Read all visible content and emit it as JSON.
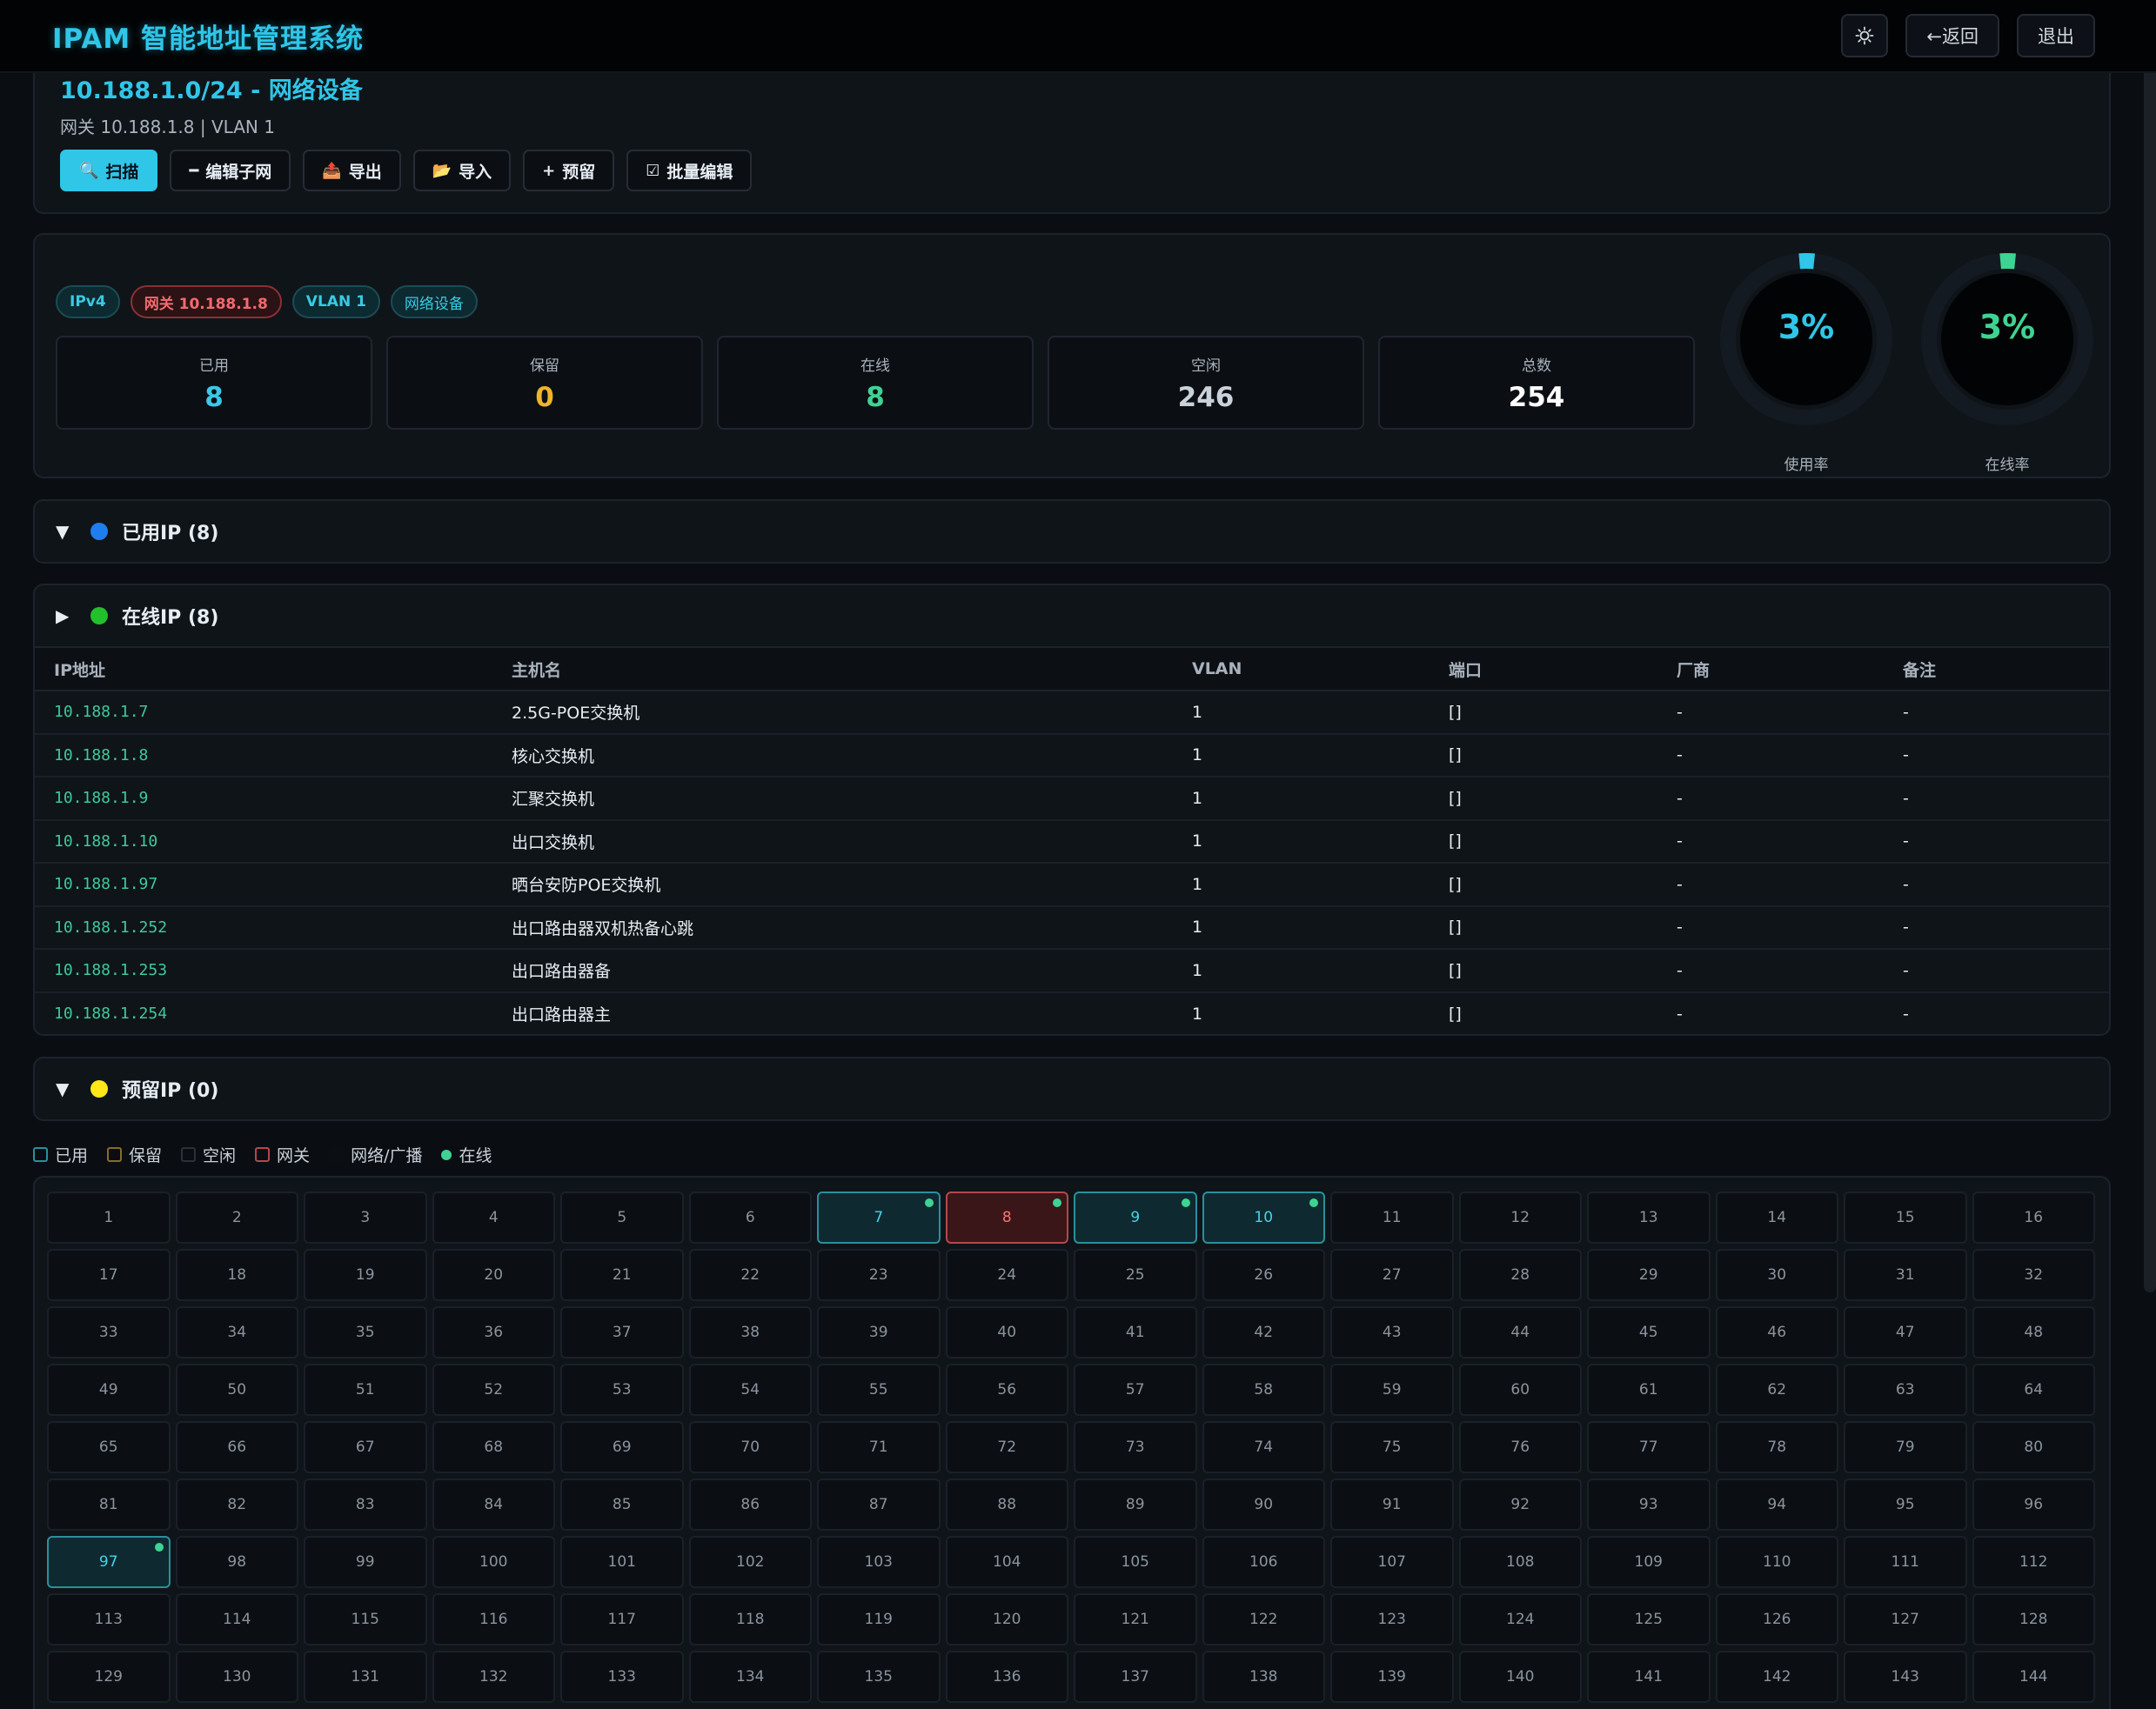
{
  "header": {
    "title": "IPAM 智能地址管理系统",
    "back_label": "←返回",
    "logout_label": "退出",
    "theme_icon": "sun-icon"
  },
  "subnet": {
    "title": "10.188.1.0/24 - 网络设备",
    "subtitle": "网关 10.188.1.8 | VLAN 1",
    "actions": [
      {
        "label": "扫描",
        "icon": "search-icon",
        "glyph": "🔍"
      },
      {
        "label": "编辑子网",
        "icon": "dash-icon",
        "glyph": "━"
      },
      {
        "label": "导出",
        "icon": "export-icon",
        "glyph": "📤"
      },
      {
        "label": "导入",
        "icon": "folder-icon",
        "glyph": "📂"
      },
      {
        "label": "预留",
        "icon": "plus-icon",
        "glyph": "+"
      },
      {
        "label": "批量编辑",
        "icon": "checkbox-icon",
        "glyph": "☑"
      }
    ]
  },
  "tags": {
    "ipv4": "IPv4",
    "gateway": "网关 10.188.1.8",
    "vlan": "VLAN 1",
    "network": "网络设备"
  },
  "stats": [
    {
      "label": "已用",
      "value": "8",
      "color": "#3cc8e6"
    },
    {
      "label": "保留",
      "value": "0",
      "color": "#f0b429"
    },
    {
      "label": "在线",
      "value": "8",
      "color": "#3ed392"
    },
    {
      "label": "空闲",
      "value": "246",
      "color": "#c9d1d9"
    },
    {
      "label": "总数",
      "value": "254",
      "color": "#ffffff"
    }
  ],
  "gauges": [
    {
      "value": "3%",
      "fraction": 0.03,
      "label": "使用率",
      "color": "#2fc6e8"
    },
    {
      "value": "3%",
      "fraction": 0.03,
      "label": "在线率",
      "color": "#3ed392"
    }
  ],
  "sections": {
    "used": {
      "title": "已用IP (8)",
      "color": "#1e7ef0"
    },
    "online": {
      "title": "在线IP (8)",
      "color": "#22c02a"
    },
    "reserved": {
      "title": "预留IP (0)",
      "color": "#ffe71a"
    }
  },
  "table": {
    "columns": [
      "IP地址",
      "主机名",
      "VLAN",
      "端口",
      "厂商",
      "备注"
    ],
    "rows": [
      [
        "10.188.1.7",
        "2.5G-POE交换机",
        "1",
        "[]",
        "-",
        "-"
      ],
      [
        "10.188.1.8",
        "核心交换机",
        "1",
        "[]",
        "-",
        "-"
      ],
      [
        "10.188.1.9",
        "汇聚交换机",
        "1",
        "[]",
        "-",
        "-"
      ],
      [
        "10.188.1.10",
        "出口交换机",
        "1",
        "[]",
        "-",
        "-"
      ],
      [
        "10.188.1.97",
        "晒台安防POE交换机",
        "1",
        "[]",
        "-",
        "-"
      ],
      [
        "10.188.1.252",
        "出口路由器双机热备心跳",
        "1",
        "[]",
        "-",
        "-"
      ],
      [
        "10.188.1.253",
        "出口路由器备",
        "1",
        "[]",
        "-",
        "-"
      ],
      [
        "10.188.1.254",
        "出口路由器主",
        "1",
        "[]",
        "-",
        "-"
      ]
    ]
  },
  "legend": [
    {
      "label": "已用",
      "color": "#2a8f9d"
    },
    {
      "label": "保留",
      "color": "#8a6a2a"
    },
    {
      "label": "空闲",
      "color": "#2a313b"
    },
    {
      "label": "网关",
      "color": "#b5474c"
    },
    {
      "label": "网络/广播",
      "color": "#0b0f13"
    },
    {
      "label": "在线",
      "color": "#3ed392"
    }
  ],
  "ip_grid": {
    "visible_cells": [
      "1",
      "2",
      "3",
      "4",
      "5",
      "6",
      "7",
      "8",
      "9",
      "10",
      "11",
      "12",
      "13",
      "14",
      "15",
      "16",
      "17",
      "18",
      "19",
      "20",
      "21",
      "22",
      "23",
      "24",
      "25",
      "26",
      "27",
      "28",
      "29",
      "30",
      "31",
      "32",
      "33",
      "34",
      "35",
      "36",
      "37",
      "38",
      "39",
      "40",
      "41",
      "42",
      "43",
      "44",
      "45",
      "46",
      "47",
      "48",
      "49",
      "50",
      "51",
      "52",
      "53",
      "54",
      "55",
      "56",
      "57",
      "58",
      "59",
      "60",
      "61",
      "62",
      "63",
      "64",
      "65",
      "66",
      "67",
      "68",
      "69",
      "70",
      "71",
      "72",
      "73",
      "74",
      "75",
      "76",
      "77",
      "78",
      "79",
      "80",
      "81",
      "82",
      "83",
      "84",
      "85",
      "86",
      "87",
      "88",
      "89",
      "90",
      "91",
      "92",
      "93",
      "94",
      "95",
      "96",
      "97",
      "98",
      "99",
      "100",
      "101",
      "102",
      "103",
      "104",
      "105",
      "106",
      "107",
      "108",
      "109",
      "110",
      "111",
      "112",
      "113",
      "114",
      "115",
      "116",
      "117",
      "118",
      "119",
      "120",
      "121",
      "122",
      "123",
      "124",
      "125",
      "126",
      "127",
      "128",
      "129",
      "130",
      "131",
      "132",
      "133",
      "134",
      "135",
      "136",
      "137",
      "138",
      "139",
      "140",
      "141",
      "142",
      "143",
      "144"
    ],
    "used": [
      "7",
      "8",
      "9",
      "10",
      "97"
    ],
    "gateway": [
      "8"
    ],
    "online": [
      "7",
      "8",
      "9",
      "10",
      "97"
    ]
  }
}
